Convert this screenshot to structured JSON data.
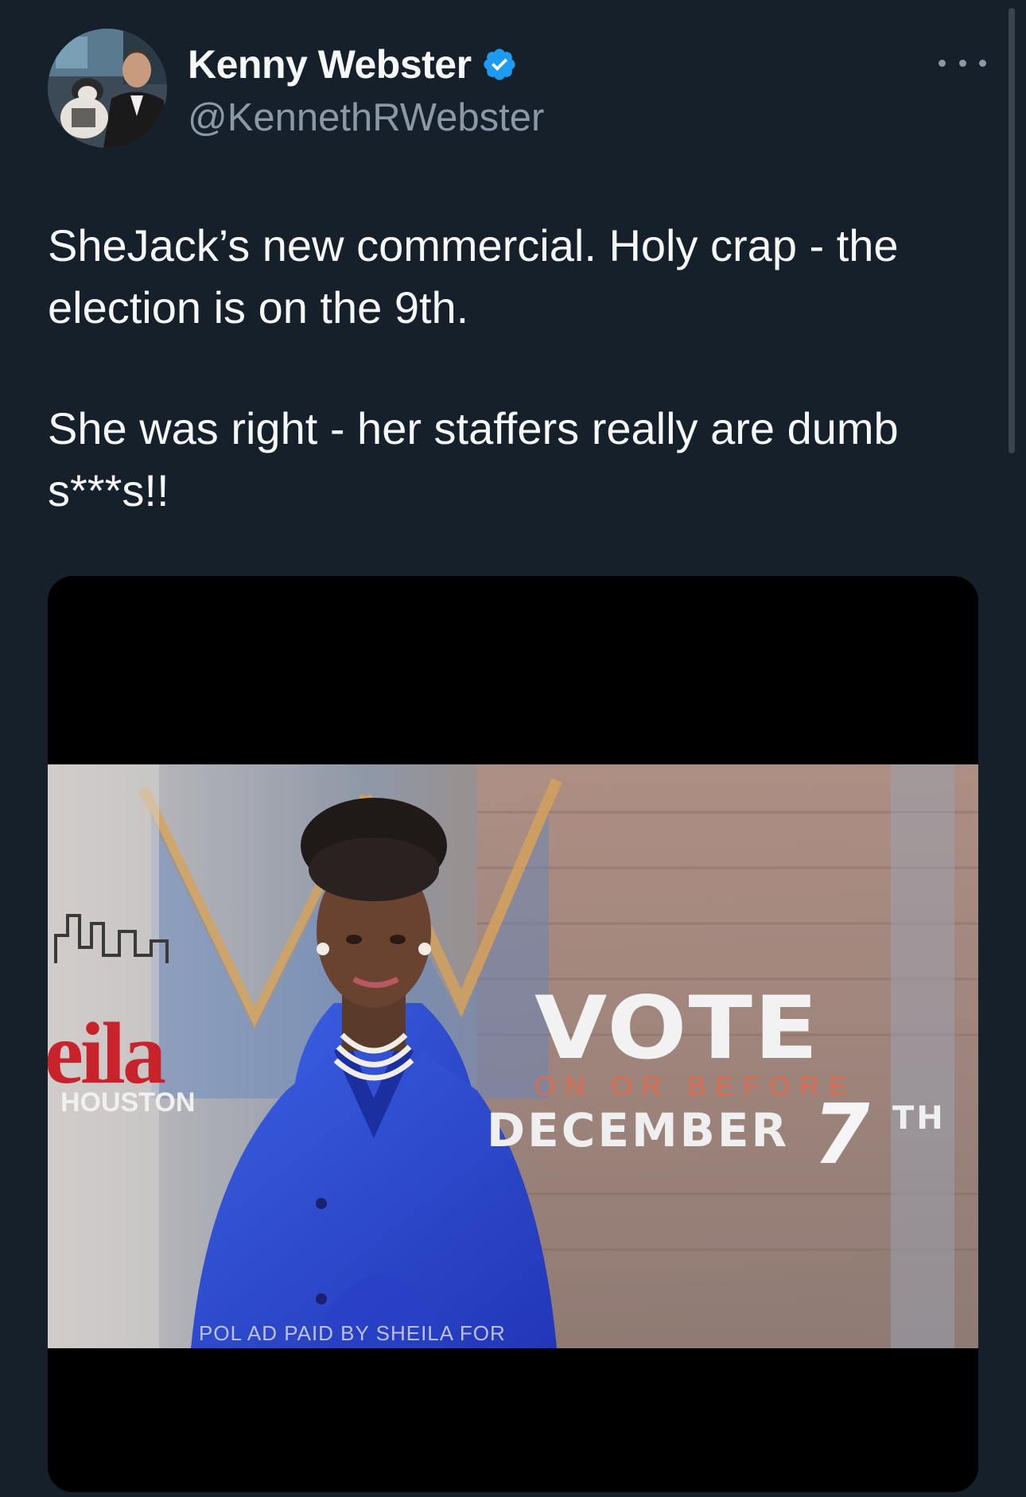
{
  "tweet": {
    "author": {
      "display_name": "Kenny Webster",
      "handle": "@KennethRWebster",
      "verified": true,
      "verified_color": "#1d9bf0"
    },
    "more_icon": "more-horizontal-icon",
    "text_line_1": "SheJack’s new commercial.  Holy crap - the election is on the 9th.",
    "text_line_2": "She was right - her staffers really are dumb s***s!!"
  },
  "media": {
    "overlay": {
      "vote": "VOTE",
      "on_or_before": "ON OR BEFORE",
      "december": "DECEMBER",
      "day": "7",
      "suffix": "TH",
      "logo_name_fragment": "eila",
      "city_fragment": "HOUSTON",
      "disclaimer_fragment": "POL AD PAID BY SHEILA FOR"
    }
  },
  "colors": {
    "background": "#15202b",
    "text_primary": "#f7f9f9",
    "text_secondary": "#8b98a5",
    "accent": "#1d9bf0"
  }
}
